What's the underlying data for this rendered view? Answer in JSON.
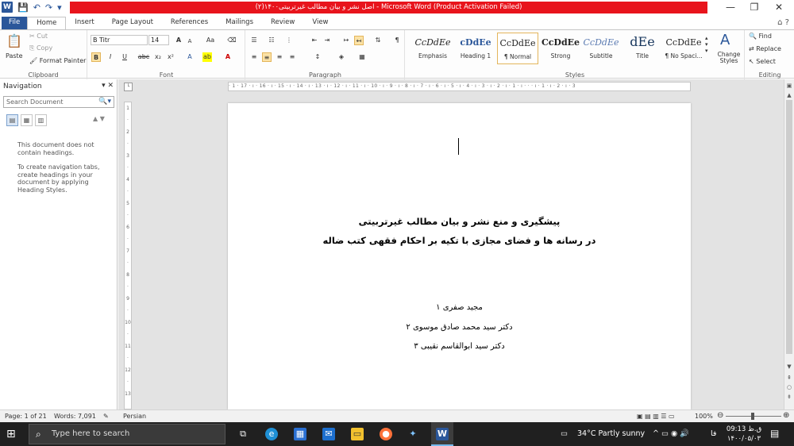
{
  "window": {
    "title": "(۲)اصل نشر و بیان مطالب غیرتربیتی۱۴۰۰ - Microsoft Word (Product Activation Failed)",
    "title_bar_color": "#e8141c"
  },
  "quick_access": {
    "app_icon": "W"
  },
  "ribbon_tabs": [
    "File",
    "Home",
    "Insert",
    "Page Layout",
    "References",
    "Mailings",
    "Review",
    "View"
  ],
  "ribbon": {
    "clipboard": {
      "paste": "Paste",
      "cut": "Cut",
      "copy": "Copy",
      "format_painter": "Format Painter",
      "label": "Clipboard"
    },
    "font": {
      "name": "B Titr",
      "size": "14",
      "label": "Font",
      "bold": "B",
      "italic": "I",
      "underline": "U",
      "strike": "abc",
      "subscript": "x₂",
      "superscript": "x²",
      "grow": "A",
      "shrink": "A",
      "case": "Aa"
    },
    "paragraph": {
      "label": "Paragraph",
      "pilcrow": "¶"
    },
    "styles": {
      "label": "Styles",
      "items": [
        {
          "sample": "CcDdEe",
          "name": "Emphasis"
        },
        {
          "sample": "cDdEe",
          "name": "Heading 1"
        },
        {
          "sample": "CcDdEe",
          "name": "¶ Normal"
        },
        {
          "sample": "CcDdEe",
          "name": "Strong"
        },
        {
          "sample": "CcDdEe",
          "name": "Subtitle"
        },
        {
          "sample": "dEe",
          "name": "Title"
        },
        {
          "sample": "CcDdEe",
          "name": "¶ No Spaci..."
        }
      ],
      "change_styles": "Change Styles"
    },
    "editing": {
      "label": "Editing",
      "find": "Find",
      "replace": "Replace",
      "select": "Select"
    }
  },
  "navigation": {
    "title": "Navigation",
    "search_placeholder": "Search Document",
    "msg1": "This document does not contain headings.",
    "msg2": "To create navigation tabs, create headings in your document by applying Heading Styles."
  },
  "ruler": {
    "horizontal": "· 1 · 17 · ı · 16 · ı · 15 · ı · 14 · ı · 13 · ı · 12 · ı · 11 · ı · 10 · ı · 9 · ı · 8 · ı · 7 · ı · 6 · ı · 5 · ı · 4 · ı · 3 · ı · 2 · ı · 1 · ı · · · ı · 1 · ı · 2 · ı · 3",
    "vertical": [
      "1",
      "·",
      "2",
      "·",
      "3",
      "·",
      "4",
      "·",
      "5",
      "·",
      "6",
      "·",
      "7",
      "·",
      "8",
      "·",
      "9",
      "·",
      "10",
      "·",
      "11",
      "·",
      "12",
      "·",
      "13"
    ]
  },
  "document": {
    "title_line1": "پیشگیری و منع  نشر و بیان مطالب  غیرتربیتی",
    "title_line2": "در رسانه ها  و فضای مجازی با تکیه بر  احکام فقهی کتب ضاله",
    "author1": "مجید صفری ۱",
    "author2": "دکتر سید محمد صادق موسوی ۲",
    "author3": "دکتر سید ابوالقاسم نقیبی ۳"
  },
  "status_bar": {
    "page": "Page: 1 of 21",
    "words": "Words: 7,091",
    "language": "Persian",
    "zoom": "100%"
  },
  "taskbar": {
    "search_placeholder": "Type here to search",
    "weather": "34°C  Partly sunny",
    "lang": "فا",
    "time": "09:13 ق.ظ",
    "date": "۱۴۰۰/۰۵/۰۳"
  }
}
